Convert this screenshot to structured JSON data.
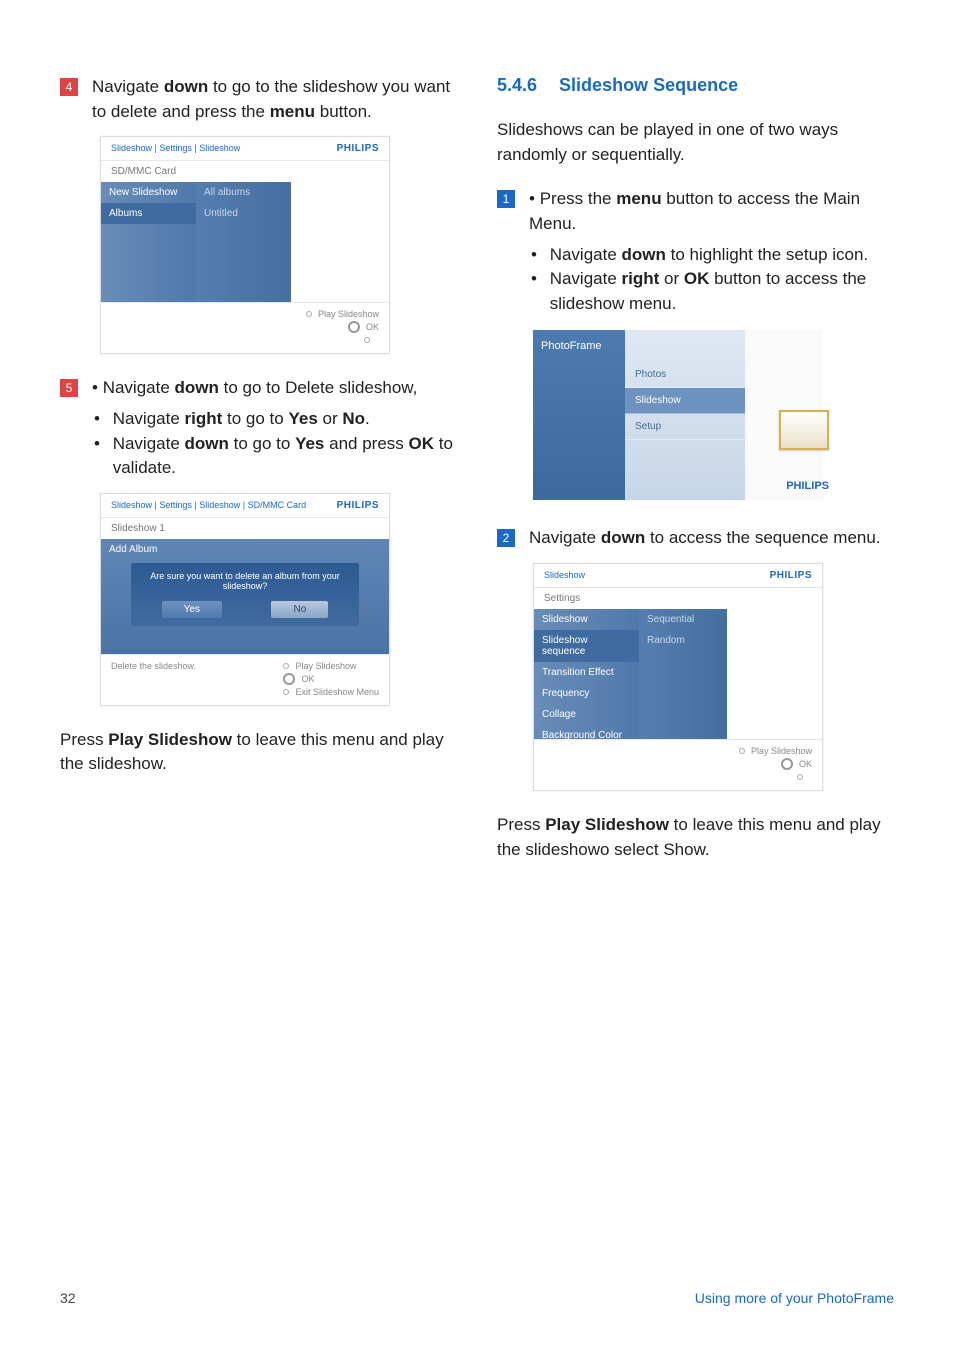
{
  "left": {
    "step4": {
      "num": "4",
      "text_before": "Navigate ",
      "b1": "down",
      "text_mid": " to go to the slideshow you want to delete and press the ",
      "b2": "menu",
      "text_after": " button."
    },
    "ss1": {
      "crumb": "Slideshow | Settings | Slideshow",
      "brand": "PHILIPS",
      "bar": "SD/MMC Card",
      "left_items": [
        "New Slideshow",
        "Albums"
      ],
      "mid_items": [
        "All albums",
        "Untitled"
      ],
      "foot_play": "Play Slideshow",
      "foot_ok": "OK"
    },
    "step5": {
      "num": "5",
      "b1_pre": "Navigate ",
      "b1_b": "down",
      "b1_post": " to go to Delete slideshow,",
      "b2_pre": "Navigate ",
      "b2_b": "right",
      "b2_mid": " to go to ",
      "b2_yes": "Yes",
      "b2_or": " or ",
      "b2_no": "No",
      "b2_post": ".",
      "b3_pre": "Navigate ",
      "b3_b": "down",
      "b3_mid": " to go to ",
      "b3_yes": "Yes",
      "b3_post": " and press ",
      "b3_ok": "OK",
      "b3_end": " to validate."
    },
    "ss2": {
      "crumb": "Slideshow | Settings | Slideshow | SD/MMC Card",
      "brand": "PHILIPS",
      "bar": "Slideshow 1",
      "left_item": "Add Album",
      "dlg_text": "Are sure you want to delete an album from your slideshow?",
      "yes": "Yes",
      "no": "No",
      "del": "Delete the slideshow.",
      "foot_play": "Play Slideshow",
      "foot_ok": "OK",
      "foot_exit": "Exit Slideshow Menu"
    },
    "para_after": {
      "pre": "Press ",
      "b": "Play Slideshow",
      "post": " to leave this menu and play the slideshow."
    }
  },
  "right": {
    "heading_num": "5.4.6",
    "heading": "Slideshow Sequence",
    "intro": "Slideshows can be played in one of two ways randomly or sequentially.",
    "step1": {
      "num": "1",
      "b1_pre": "Press the ",
      "b1_b": "menu",
      "b1_post": " button to access the Main Menu.",
      "b2_pre": "Navigate ",
      "b2_b": "down",
      "b2_post": " to highlight the setup icon.",
      "b3_pre": "Navigate ",
      "b3_b1": "right",
      "b3_mid": " or ",
      "b3_b2": "OK",
      "b3_post": " button to access the slideshow menu."
    },
    "pf": {
      "title": "PhotoFrame",
      "items": [
        "Photos",
        "Slideshow",
        "Setup"
      ],
      "brand": "PHILIPS"
    },
    "step2": {
      "num": "2",
      "pre": "Navigate ",
      "b": "down",
      "post": " to access the sequence menu."
    },
    "ss3": {
      "crumb": "Slideshow",
      "brand": "PHILIPS",
      "bar": "Settings",
      "left_items": [
        "Slideshow",
        "Slideshow sequence",
        "Transition Effect",
        "Frequency",
        "Collage",
        "Background Color"
      ],
      "mid_items": [
        "Sequential",
        "Random"
      ],
      "foot_play": "Play Slideshow",
      "foot_ok": "OK"
    },
    "para_after": {
      "pre": "Press ",
      "b": "Play Slideshow",
      "post": " to leave this menu and play the slideshowo select Show."
    }
  },
  "footer": {
    "page": "32",
    "label": "Using more of your PhotoFrame"
  }
}
